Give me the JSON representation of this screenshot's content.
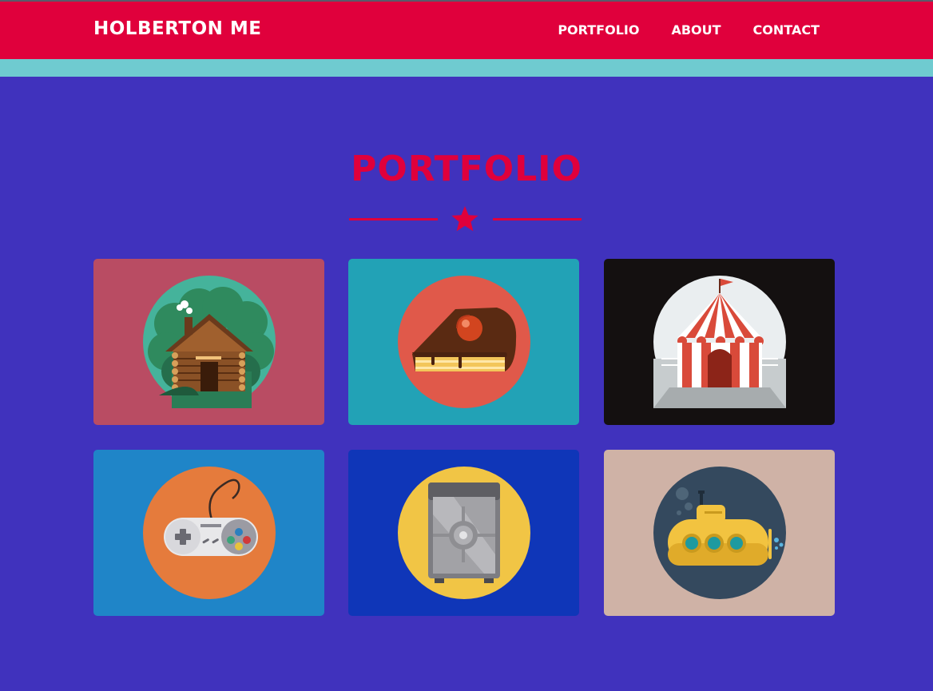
{
  "header": {
    "brand": "HOLBERTON ME",
    "nav": [
      {
        "label": "PORTFOLIO"
      },
      {
        "label": "ABOUT"
      },
      {
        "label": "CONTACT"
      }
    ]
  },
  "section": {
    "title": "PORTFOLIO",
    "divider_icon": "star-icon"
  },
  "portfolio": {
    "items": [
      {
        "icon": "log-cabin-icon",
        "background": "#b94c63",
        "circle": "#45b39b"
      },
      {
        "icon": "cake-slice-icon",
        "background": "#22a2b6",
        "circle": "#e0594a"
      },
      {
        "icon": "circus-tent-icon",
        "background": "#141010",
        "circle": "#eaeef0"
      },
      {
        "icon": "game-controller-icon",
        "background": "#1f85c8",
        "circle": "#e57b3c"
      },
      {
        "icon": "safe-icon",
        "background": "#0f36b8",
        "circle": "#f1c545"
      },
      {
        "icon": "submarine-icon",
        "background": "#cfb2a6",
        "circle": "#34495e"
      }
    ]
  },
  "colors": {
    "accent": "#e0003c",
    "page_background": "#4032bd",
    "strip": "#6fcbd0"
  }
}
